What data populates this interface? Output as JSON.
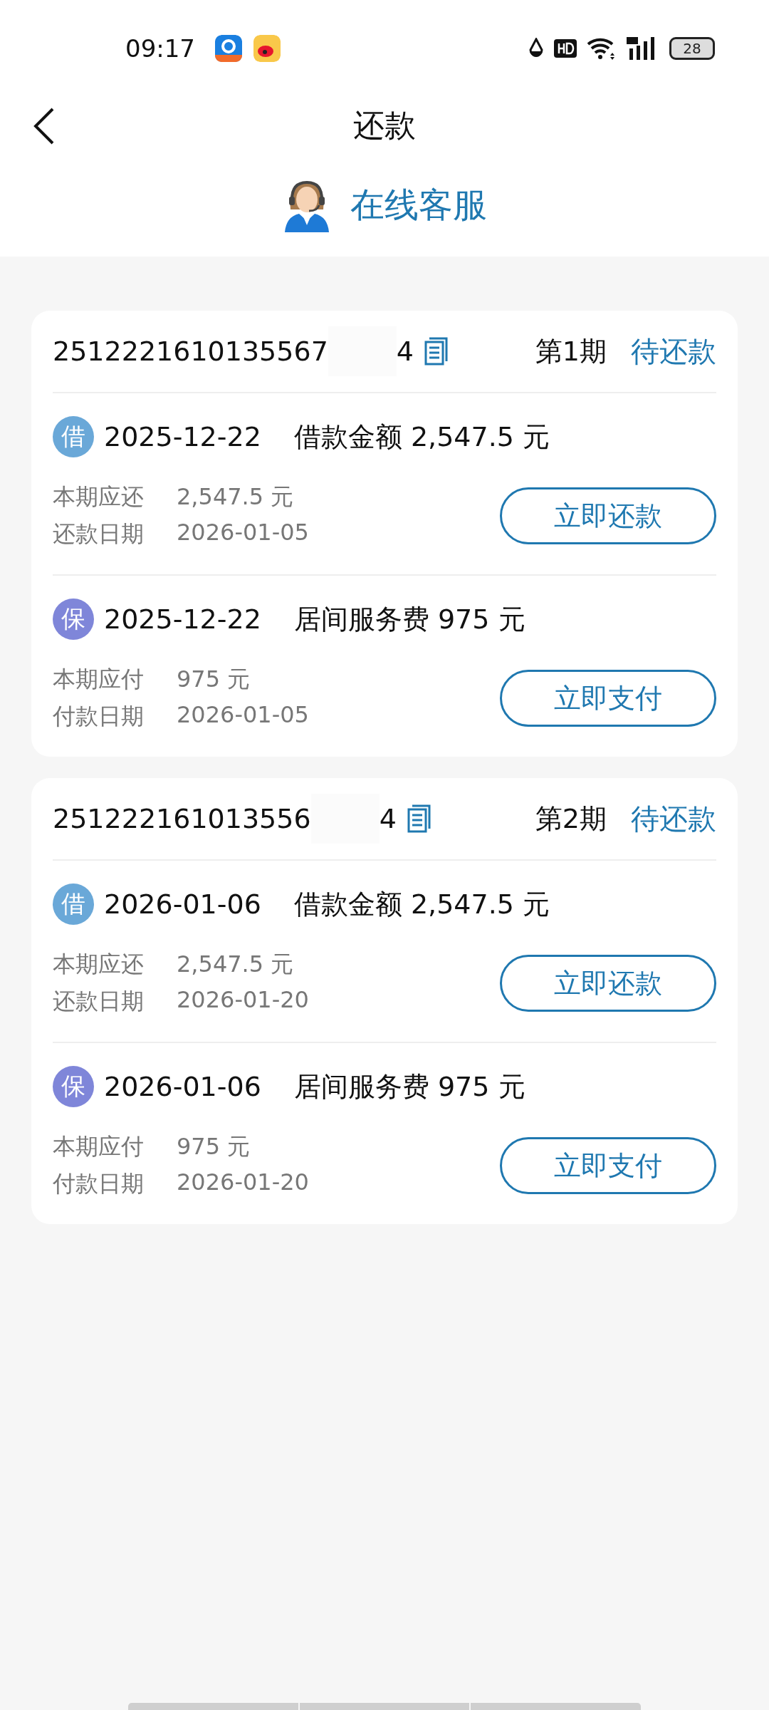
{
  "status_bar": {
    "time": "09:17",
    "battery": "28"
  },
  "header": {
    "title": "还款"
  },
  "service": {
    "label": "在线客服"
  },
  "cards": [
    {
      "order_no_start": "2512221610135567",
      "order_no_end": "4",
      "period": "第1期",
      "status": "待还款",
      "items": [
        {
          "kind": "loan",
          "badge": "借",
          "date": "2025-12-22",
          "summary": "借款金额 2,547.5 元",
          "amount_label": "本期应还",
          "amount": "2,547.5 元",
          "date_label": "还款日期",
          "due_date": "2026-01-05",
          "button": "立即还款"
        },
        {
          "kind": "fee",
          "badge": "保",
          "date": "2025-12-22",
          "summary": "居间服务费 975 元",
          "amount_label": "本期应付",
          "amount": "975 元",
          "date_label": "付款日期",
          "due_date": "2026-01-05",
          "button": "立即支付"
        }
      ]
    },
    {
      "order_no_start": "251222161013556",
      "order_no_end": "4",
      "period": "第2期",
      "status": "待还款",
      "items": [
        {
          "kind": "loan",
          "badge": "借",
          "date": "2026-01-06",
          "summary": "借款金额 2,547.5 元",
          "amount_label": "本期应还",
          "amount": "2,547.5 元",
          "date_label": "还款日期",
          "due_date": "2026-01-20",
          "button": "立即还款"
        },
        {
          "kind": "fee",
          "badge": "保",
          "date": "2026-01-06",
          "summary": "居间服务费 975 元",
          "amount_label": "本期应付",
          "amount": "975 元",
          "date_label": "付款日期",
          "due_date": "2026-01-20",
          "button": "立即支付"
        }
      ]
    }
  ]
}
